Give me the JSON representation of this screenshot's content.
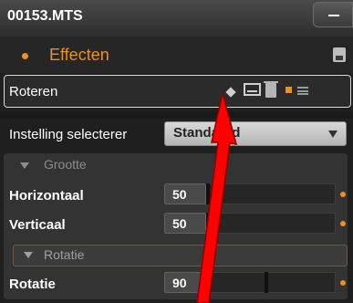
{
  "window": {
    "title": "00153.MTS"
  },
  "effects_header": {
    "label": "Effecten",
    "accent": "#f08f1e"
  },
  "effect_panel": {
    "name": "Roteren",
    "icons": [
      "diamond-icon",
      "preset-icon",
      "trash-icon",
      "orange-square-icon",
      "menu-icon"
    ]
  },
  "preset": {
    "label": "Instelling selecterer",
    "value": "Standaard"
  },
  "groups": [
    {
      "name": "Grootte",
      "rows": [
        {
          "label": "Horizontaal",
          "value": "50"
        },
        {
          "label": "Verticaal",
          "value": "50"
        }
      ]
    },
    {
      "name": "Rotatie",
      "rows": [
        {
          "label": "Rotatie",
          "value": "90"
        }
      ]
    }
  ],
  "annotation": {
    "color": "#ff0000",
    "icon": "red-arrow"
  }
}
